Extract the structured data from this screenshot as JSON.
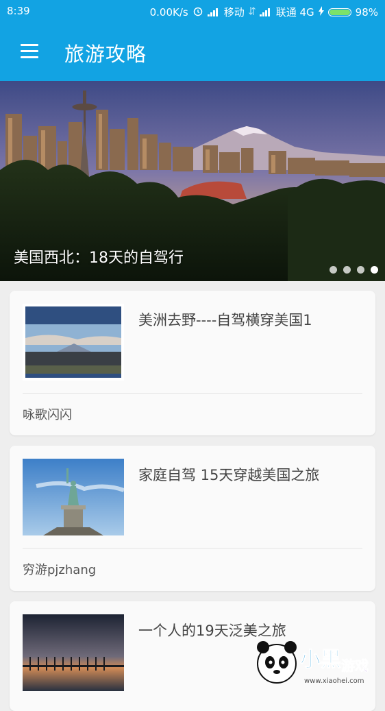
{
  "status": {
    "time": "8:39",
    "speed": "0.00K/s",
    "carrier1": "移动",
    "carrier2": "联通 4G",
    "battery": "98%"
  },
  "appbar": {
    "title": "旅游攻略"
  },
  "banner": {
    "caption": "美国西北：18天的自驾行",
    "dot_count": 4,
    "active_dot": 4
  },
  "cards": [
    {
      "title": "美洲去野----自驾横穿美国1",
      "author": "咏歌闪闪"
    },
    {
      "title": "家庭自驾 15天穿越美国之旅",
      "author": "穷游pjzhang"
    },
    {
      "title": "一个人的19天泛美之旅",
      "author": ""
    }
  ],
  "watermark": {
    "brand": "小黑游戏",
    "url": "www.xiaohei.com"
  }
}
